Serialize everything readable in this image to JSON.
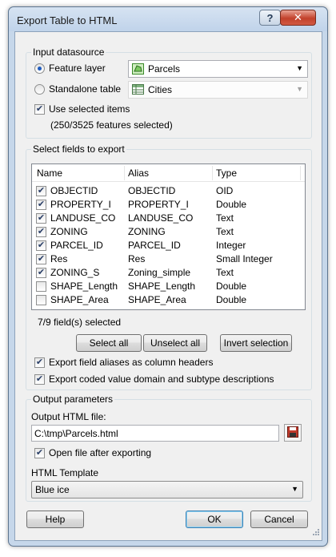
{
  "window": {
    "title": "Export Table to HTML",
    "help_button": "?",
    "close_button": "✕"
  },
  "input_datasource": {
    "legend": "Input datasource",
    "feature_layer": {
      "label": "Feature layer",
      "selected": true,
      "value": "Parcels",
      "icon": "polygon-layer-icon"
    },
    "standalone_table": {
      "label": "Standalone table",
      "selected": false,
      "value": "Cities",
      "icon": "table-icon",
      "enabled": false
    },
    "use_selected": {
      "label": "Use selected items",
      "checked": true
    },
    "selection_info": "(250/3525 features selected)"
  },
  "fields": {
    "legend": "Select fields to export",
    "columns": [
      "Name",
      "Alias",
      "Type"
    ],
    "rows": [
      {
        "checked": true,
        "name": "OBJECTID",
        "alias": "OBJECTID",
        "type": "OID"
      },
      {
        "checked": true,
        "name": "PROPERTY_I",
        "alias": "PROPERTY_I",
        "type": "Double"
      },
      {
        "checked": true,
        "name": "LANDUSE_CO",
        "alias": "LANDUSE_CO",
        "type": "Text"
      },
      {
        "checked": true,
        "name": "ZONING",
        "alias": "ZONING",
        "type": "Text"
      },
      {
        "checked": true,
        "name": "PARCEL_ID",
        "alias": "PARCEL_ID",
        "type": "Integer"
      },
      {
        "checked": true,
        "name": "Res",
        "alias": "Res",
        "type": "Small Integer"
      },
      {
        "checked": true,
        "name": "ZONING_S",
        "alias": "Zoning_simple",
        "type": "Text"
      },
      {
        "checked": false,
        "name": "SHAPE_Length",
        "alias": "SHAPE_Length",
        "type": "Double"
      },
      {
        "checked": false,
        "name": "SHAPE_Area",
        "alias": "SHAPE_Area",
        "type": "Double"
      }
    ],
    "count_text": "7/9 field(s) selected",
    "select_all": "Select all",
    "unselect_all": "Unselect all",
    "invert_selection": "Invert selection",
    "export_aliases": {
      "label": "Export field aliases as column headers",
      "checked": true
    },
    "export_coded": {
      "label": "Export coded value domain and subtype descriptions",
      "checked": true
    }
  },
  "output": {
    "legend": "Output parameters",
    "file_label": "Output HTML file:",
    "file_value": "C:\\tmp\\Parcels.html",
    "save_icon": "floppy-disk-icon",
    "open_after": {
      "label": "Open file after exporting",
      "checked": true
    },
    "template_label": "HTML Template",
    "template_value": "Blue ice"
  },
  "footer": {
    "help": "Help",
    "ok": "OK",
    "cancel": "Cancel"
  },
  "colors": {
    "accent": "#1f5cbf",
    "frame": "#c6d7ea",
    "client": "#f0f0f0",
    "close": "#c2412b"
  }
}
